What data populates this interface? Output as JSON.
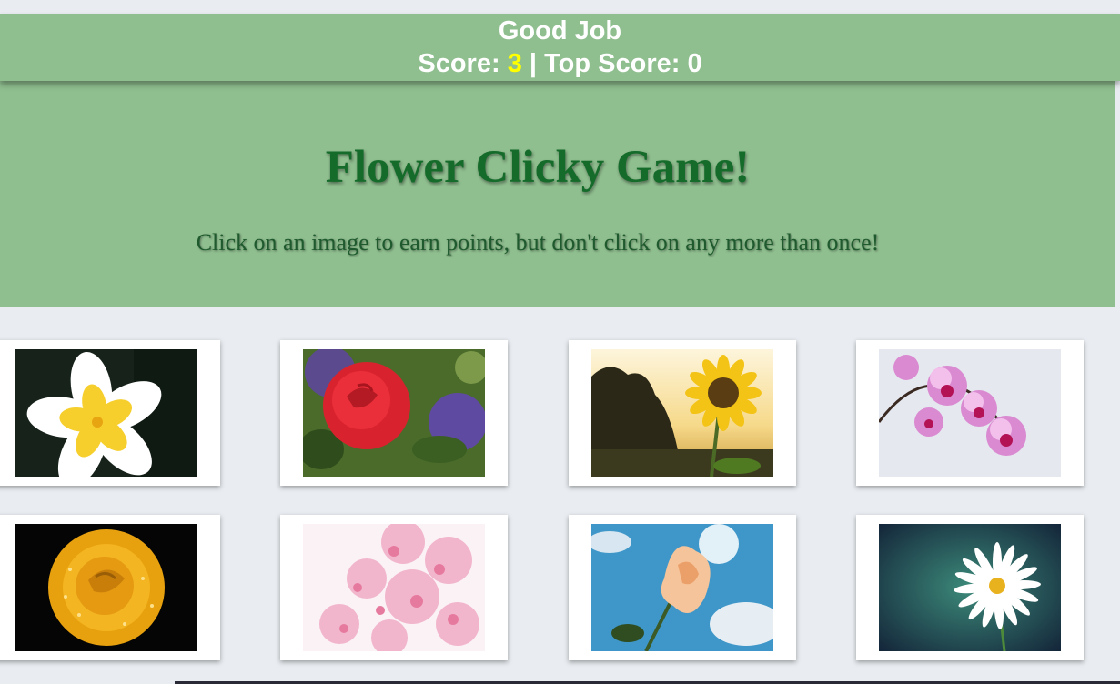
{
  "navbar": {
    "message": "Good Job",
    "score_label": "Score:",
    "score_value": "3",
    "separator": "|",
    "top_score_label": "Top Score:",
    "top_score_value": "0"
  },
  "jumbotron": {
    "title": "Flower Clicky Game!",
    "subtitle": "Click on an image to earn points, but don't click on any more than once!"
  },
  "colors": {
    "banner": "#8fbe8f",
    "title": "#146b2a",
    "score_highlight": "#ffff00",
    "background": "#e9edf1"
  },
  "cards": [
    {
      "flower": "plumeria-image"
    },
    {
      "flower": "red-rose-image"
    },
    {
      "flower": "sunflower-image"
    },
    {
      "flower": "orchid-image"
    },
    {
      "flower": "yellow-rose-image"
    },
    {
      "flower": "cherry-blossom-image"
    },
    {
      "flower": "peach-hibiscus-image"
    },
    {
      "flower": "daisy-image"
    }
  ]
}
